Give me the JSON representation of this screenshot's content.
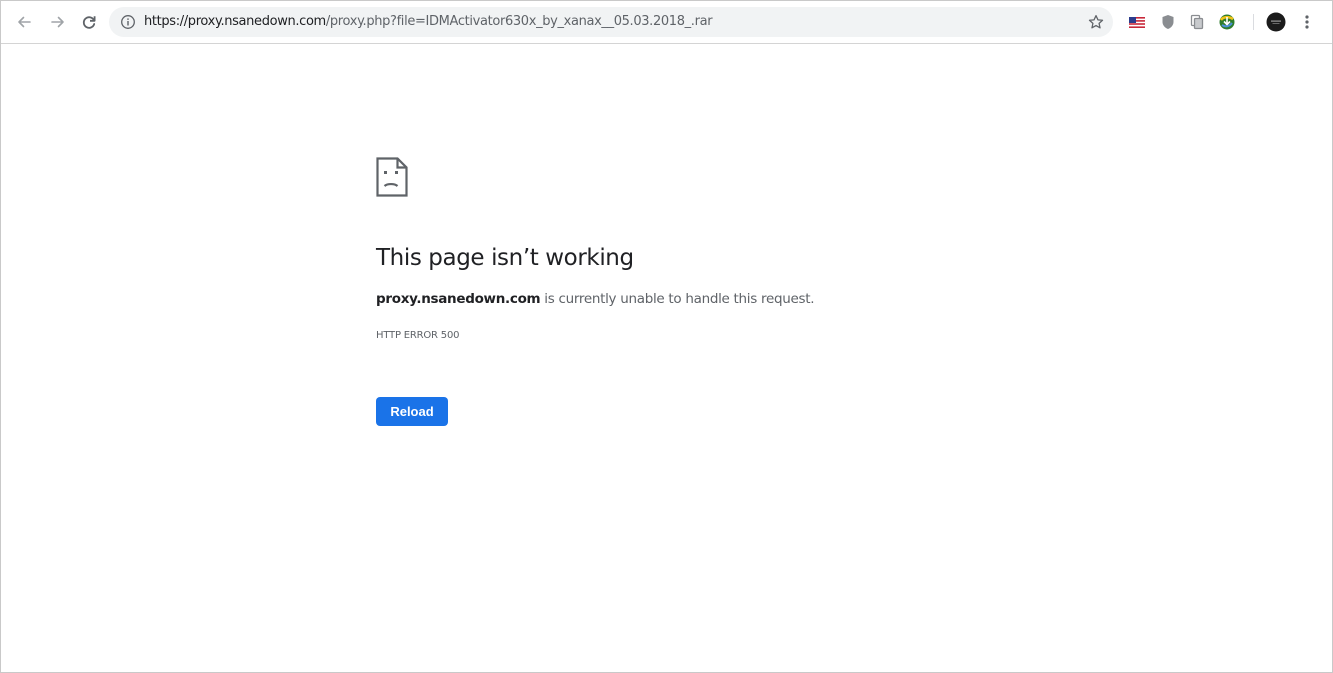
{
  "browser": {
    "url_host": "https://proxy.nsanedown.com",
    "url_path": "/proxy.php?file=IDMActivator630x_by_xanax__05.03.2018_.rar",
    "icons": {
      "back": "arrow-left-icon",
      "forward": "arrow-right-icon",
      "reload": "reload-icon",
      "site_info": "info-icon",
      "bookmark": "star-icon",
      "extensions": [
        "us-flag-icon",
        "shield-icon",
        "copy-icon",
        "download-manager-icon"
      ],
      "profile": "avatar",
      "menu": "more-vert-icon"
    }
  },
  "error": {
    "icon": "sad-page-icon",
    "title": "This page isn’t working",
    "host": "proxy.nsanedown.com",
    "message": " is currently unable to handle this request.",
    "code": "HTTP ERROR 500",
    "reload_label": "Reload"
  },
  "colors": {
    "accent": "#1a73e8",
    "text_primary": "#202124",
    "text_secondary": "#5f6368",
    "omnibox_bg": "#f1f3f4"
  }
}
